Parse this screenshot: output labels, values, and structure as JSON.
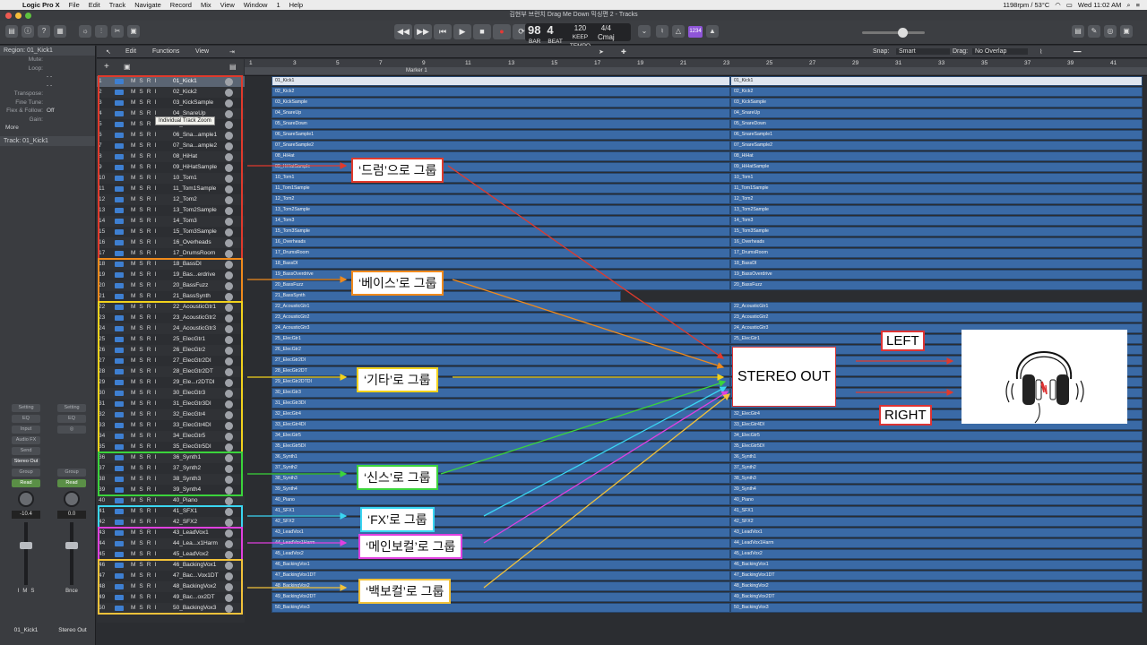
{
  "menubar": {
    "app": "Logic Pro X",
    "items": [
      "File",
      "Edit",
      "Track",
      "Navigate",
      "Record",
      "Mix",
      "View",
      "Window",
      "1",
      "Help"
    ],
    "status": "1198rpm / 53°C",
    "clock": "Wed 11:02 AM"
  },
  "window": {
    "title": "김현부 브런치 Drag Me Down 믹싱편 2 - Tracks"
  },
  "lcd": {
    "bar": "98",
    "beat": "4",
    "bar_label": "BAR",
    "beat_label": "BEAT",
    "tempo": "120",
    "tempo_label": "TEMPO",
    "keep": "KEEP",
    "sig": "4/4",
    "key": "Cmaj"
  },
  "counter": "1234",
  "inspector": {
    "region_header": "Region: 01_Kick1",
    "fields": [
      {
        "k": "Mute:",
        "v": ""
      },
      {
        "k": "Loop:",
        "v": ""
      },
      {
        "k": "",
        "v": "- -"
      },
      {
        "k": "",
        "v": "- -"
      },
      {
        "k": "Transpose:",
        "v": ""
      },
      {
        "k": "Fine Tune:",
        "v": ""
      },
      {
        "k": "Flex & Follow:",
        "v": "Off"
      },
      {
        "k": "Gain:",
        "v": ""
      }
    ],
    "more": "More",
    "track_header": "Track:  01_Kick1",
    "strip_left": {
      "setting": "Setting",
      "eq": "EQ",
      "input": "Input",
      "audio_fx": "Audio FX",
      "send": "Send",
      "output": "Stereo Out",
      "group": "Group",
      "read": "Read",
      "volume": "-10.4",
      "name": "01_Kick1",
      "m": "M",
      "s": "S",
      "i": "I"
    },
    "strip_right": {
      "setting": "Setting",
      "eq": "EQ",
      "group": "Group",
      "read": "Read",
      "volume": "0.0",
      "bnce": "Bnce",
      "name": "Stereo Out"
    }
  },
  "tracks_header": {
    "edit": "Edit",
    "functions": "Functions",
    "view": "View",
    "snap_label": "Snap:",
    "snap_value": "Smart",
    "drag_label": "Drag:",
    "drag_value": "No Overlap"
  },
  "ruler": {
    "ticks": [
      "1",
      "3",
      "5",
      "7",
      "9",
      "11",
      "13",
      "15",
      "17",
      "19",
      "21",
      "23",
      "25",
      "27",
      "29",
      "31",
      "33",
      "35",
      "37",
      "39",
      "41"
    ],
    "marker": "Marker 1"
  },
  "tooltip": "Individual Track Zoom",
  "track_controls": {
    "m": "M",
    "s": "S",
    "r": "R",
    "i": "I"
  },
  "tracks": [
    "01_Kick1",
    "02_Kick2",
    "03_KickSample",
    "04_SnareUp",
    "05_SnareDown",
    "06_Sna...ample1",
    "07_Sna...ample2",
    "08_HiHat",
    "09_HiHatSample",
    "10_Tom1",
    "11_Tom1Sample",
    "12_Tom2",
    "13_Tom2Sample",
    "14_Tom3",
    "15_Tom3Sample",
    "16_Overheads",
    "17_DrumsRoom",
    "18_BassDI",
    "19_Bas...erdrive",
    "20_BassFuzz",
    "21_BassSynth",
    "22_AcousticGtr1",
    "23_AcousticGtr2",
    "24_AcousticGtr3",
    "25_ElecGtr1",
    "26_ElecGtr2",
    "27_ElecGtr2DI",
    "28_ElecGtr2DT",
    "29_Ele...r2DTDI",
    "30_ElecGtr3",
    "31_ElecGtr3DI",
    "32_ElecGtr4",
    "33_ElecGtr4DI",
    "34_ElecGtr5",
    "35_ElecGtr5DI",
    "36_Synth1",
    "37_Synth2",
    "38_Synth3",
    "39_Synth4",
    "40_Piano",
    "41_SFX1",
    "42_SFX2",
    "43_LeadVox1",
    "44_Lea...x1Harm",
    "45_LeadVox2",
    "46_BackingVox1",
    "47_Bac...Vox1DT",
    "48_BackingVox2",
    "49_Bac...ox2DT",
    "50_BackingVox3"
  ],
  "regions": [
    "01_Kick1",
    "02_Kick2",
    "03_KickSample",
    "04_SnareUp",
    "05_SnareDown",
    "06_SnareSample1",
    "07_SnareSample2",
    "08_HiHat",
    "09_HiHatSample",
    "10_Tom1",
    "11_Tom1Sample",
    "12_Tom2",
    "13_Tom2Sample",
    "14_Tom3",
    "15_Tom3Sample",
    "16_Overheads",
    "17_DrumsRoom",
    "18_BassDI",
    "19_BassOverdrive",
    "20_BassFuzz",
    "21_BassSynth",
    "22_AcousticGtr1",
    "23_AcousticGtr2",
    "24_AcousticGtr3",
    "25_ElecGtr1",
    "26_ElecGtr2",
    "27_ElecGtr2DI",
    "28_ElecGtr2DT",
    "29_ElecGtr2DTDI",
    "30_ElecGtr3",
    "31_ElecGtr3DI",
    "32_ElecGtr4",
    "33_ElecGtr4DI",
    "34_ElecGtr5",
    "35_ElecGtr5DI",
    "36_Synth1",
    "37_Synth2",
    "38_Synth3",
    "39_Synth4",
    "40_Piano",
    "41_SFX1",
    "42_SFX2",
    "43_LeadVox1",
    "44_LeadVox1Harm",
    "45_LeadVox2",
    "46_BackingVox1",
    "47_BackingVox1DT",
    "48_BackingVox2",
    "49_BackingVox2DT",
    "50_BackingVox3"
  ],
  "groups": [
    {
      "label": "‘드럼’으로 그룹",
      "color": "#e03a2c",
      "first": 1,
      "last": 17
    },
    {
      "label": "‘베이스’로 그룹",
      "color": "#f08a1c",
      "first": 18,
      "last": 21
    },
    {
      "label": "‘기타’로 그룹",
      "color": "#f2d21c",
      "first": 22,
      "last": 35
    },
    {
      "label": "‘신스’로 그룹",
      "color": "#3bd43b",
      "first": 36,
      "last": 39
    },
    {
      "label": "‘FX’로 그룹",
      "color": "#3ad6f2",
      "first": 41,
      "last": 42
    },
    {
      "label": "‘메인보컬’로 그룹",
      "color": "#e040e0",
      "first": 43,
      "last": 45
    },
    {
      "label": "‘백보컬’로 그룹",
      "color": "#f2c23a",
      "first": 46,
      "last": 50
    }
  ],
  "stereo_out": "STEREO OUT",
  "left": "LEFT",
  "right": "RIGHT"
}
